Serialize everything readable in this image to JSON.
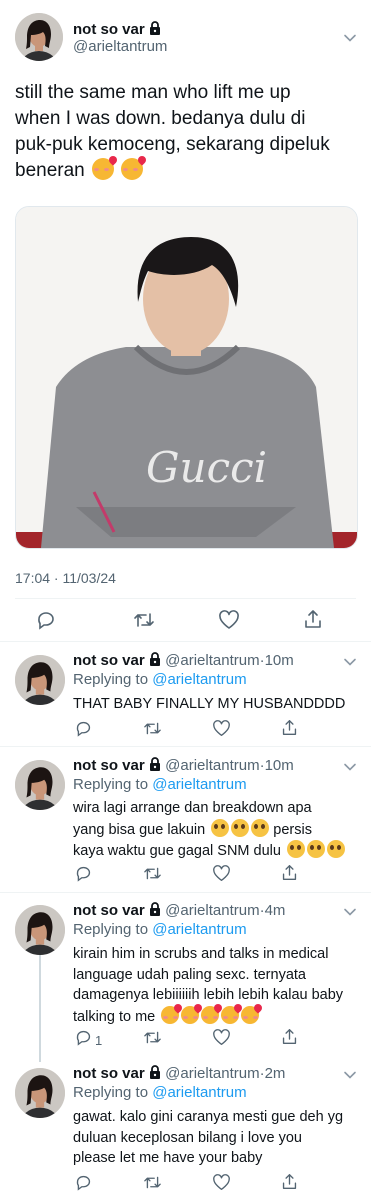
{
  "main_tweet": {
    "name": "not so var",
    "handle": "@arieltantrum",
    "text_lines": [
      "still the same man who lift me up",
      "when I was down. bedanya dulu di",
      "puk-puk kemoceng, sekarang dipeluk",
      "beneran"
    ],
    "timestamp": "17:04 · 11/03/24",
    "image_caption": "Gucci"
  },
  "replies": [
    {
      "name": "not so var",
      "handle": "@arieltantrum",
      "time": "10m",
      "replying_label": "Replying to",
      "replying_to": "@arieltantrum",
      "lines": [
        "THAT BABY FINALLY MY HUSBANDDDD"
      ],
      "reply_count": ""
    },
    {
      "name": "not so var",
      "handle": "@arieltantrum",
      "time": "10m",
      "replying_label": "Replying to",
      "replying_to": "@arieltantrum",
      "lines": [
        "wira lagi arrange dan breakdown apa",
        "yang bisa gue lakuin",
        "persis",
        "kaya waktu gue gagal SNM dulu"
      ],
      "reply_count": ""
    },
    {
      "name": "not so var",
      "handle": "@arieltantrum",
      "time": "4m",
      "replying_label": "Replying to",
      "replying_to": "@arieltantrum",
      "lines": [
        "kirain him in scrubs and talks in medical",
        "language udah paling sexc. ternyata",
        "damagenya lebiiiiiih lebih lebih kalau baby",
        "talking to me"
      ],
      "reply_count": "1"
    },
    {
      "name": "not so var",
      "handle": "@arieltantrum",
      "time": "2m",
      "replying_label": "Replying to",
      "replying_to": "@arieltantrum",
      "lines": [
        "gawat. kalo gini caranya mesti gue deh yg",
        "duluan keceplosan bilang i love you",
        "please let me have your baby"
      ],
      "reply_count": ""
    }
  ],
  "icons": {
    "lock": "lock-icon",
    "more": "chevron-down-icon",
    "reply": "reply-icon",
    "retweet": "retweet-icon",
    "like": "heart-icon",
    "share": "share-icon"
  },
  "colors": {
    "link": "#1d9bf0",
    "muted": "#536471",
    "divider": "#eff3f4"
  }
}
